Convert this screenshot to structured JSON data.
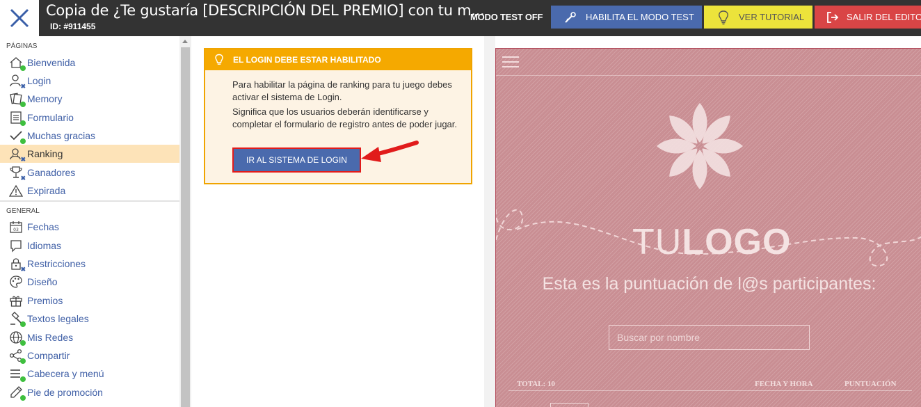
{
  "topbar": {
    "title": "Copia de ¿Te gustaría [DESCRIPCIÓN DEL PREMIO] con tu m...",
    "id_label": "ID: #911455",
    "test_mode_status": "MODO TEST OFF",
    "enable_test_label": "HABILITA EL MODO TEST",
    "tutorial_label": "VER TUTORIAL",
    "exit_label": "SALIR DEL EDITOR",
    "colors": {
      "bar": "#333333",
      "enable_test": "#4a6aad",
      "tutorial": "#ece33b",
      "exit": "#d94546"
    }
  },
  "sidebar": {
    "pages_title": "PÁGINAS",
    "pages": [
      {
        "label": "Bienvenida",
        "icon": "home-icon",
        "status": "ok"
      },
      {
        "label": "Login",
        "icon": "user-icon",
        "status": "disabled"
      },
      {
        "label": "Memory",
        "icon": "cards-icon",
        "status": "ok"
      },
      {
        "label": "Formulario",
        "icon": "form-icon",
        "status": "ok"
      },
      {
        "label": "Muchas gracias",
        "icon": "check-icon",
        "status": "ok"
      },
      {
        "label": "Ranking",
        "icon": "ranking-user-icon",
        "status": "disabled",
        "active": true
      },
      {
        "label": "Ganadores",
        "icon": "trophy-icon",
        "status": "disabled"
      },
      {
        "label": "Expirada",
        "icon": "warning-icon",
        "status": "none"
      }
    ],
    "general_title": "GENERAL",
    "general": [
      {
        "label": "Fechas",
        "icon": "calendar-icon",
        "status": "none"
      },
      {
        "label": "Idiomas",
        "icon": "speech-bubble-icon",
        "status": "none"
      },
      {
        "label": "Restricciones",
        "icon": "lock-icon",
        "status": "disabled"
      },
      {
        "label": "Diseño",
        "icon": "palette-icon",
        "status": "none"
      },
      {
        "label": "Premios",
        "icon": "gift-icon",
        "status": "none"
      },
      {
        "label": "Textos legales",
        "icon": "gavel-icon",
        "status": "ok"
      },
      {
        "label": "Mis Redes",
        "icon": "globe-icon",
        "status": "ok"
      },
      {
        "label": "Compartir",
        "icon": "share-icon",
        "status": "ok"
      },
      {
        "label": "Cabecera y menú",
        "icon": "menu-lines-icon",
        "status": "ok"
      },
      {
        "label": "Pie de promoción",
        "icon": "pen-icon",
        "status": "ok"
      }
    ],
    "status_colors": {
      "ok": "#3fbf3f",
      "disabled": "#3a5fa8"
    }
  },
  "notice": {
    "title": "EL LOGIN DEBE ESTAR HABILITADO",
    "paragraph_1": "Para habilitar la página de ranking para tu juego debes activar el sistema de Login.",
    "paragraph_2": "Significa que los usuarios deberán identificarse y completar el formulario de registro antes de poder jugar.",
    "button_label": "IR AL SISTEMA DE LOGIN",
    "colors": {
      "header": "#f5a900",
      "body": "#fdf3e4",
      "button": "#4a6aad",
      "highlight": "#e11b1b"
    }
  },
  "preview": {
    "logo_light": "TU",
    "logo_bold": "LOGO",
    "heading": "Esta es la puntuación de l@s participantes:",
    "search_placeholder": "Buscar por nombre",
    "total_label": "TOTAL: 10",
    "col_date": "FECHA Y HORA",
    "col_score": "PUNTUACIÓN",
    "colors": {
      "background": "#c98e93",
      "text": "#f4e2e2"
    }
  }
}
